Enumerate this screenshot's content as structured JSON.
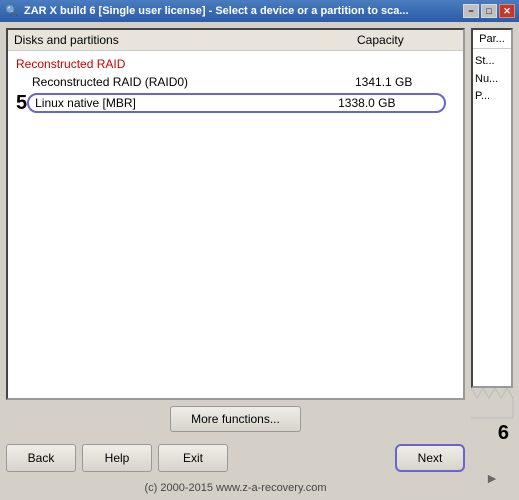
{
  "titleBar": {
    "icon": "🔍",
    "text": "ZAR X build 6 [Single user license] - Select a device or a partition to sca...",
    "minimizeLabel": "−",
    "maximizeLabel": "□",
    "closeLabel": "✕"
  },
  "tableHeader": {
    "nameCol": "Disks and partitions",
    "capacityCol": "Capacity"
  },
  "groupLabel": "Reconstructed RAID",
  "diskRows": [
    {
      "name": "Reconstructed RAID (RAID0)",
      "capacity": "1341.1 GB",
      "selected": false,
      "rowNumber": ""
    },
    {
      "name": "Linux native [MBR]",
      "capacity": "1338.0 GB",
      "selected": true,
      "rowNumber": "5"
    }
  ],
  "sidePanel": {
    "header": "Par...",
    "lines": [
      "St...",
      "Nu...",
      "P..."
    ]
  },
  "sideNumber": "6",
  "moreFunctionsLabel": "More functions...",
  "buttons": {
    "back": "Back",
    "help": "Help",
    "exit": "Exit",
    "next": "Next"
  },
  "footerText": "(c) 2000-2015 www.z-a-recovery.com"
}
